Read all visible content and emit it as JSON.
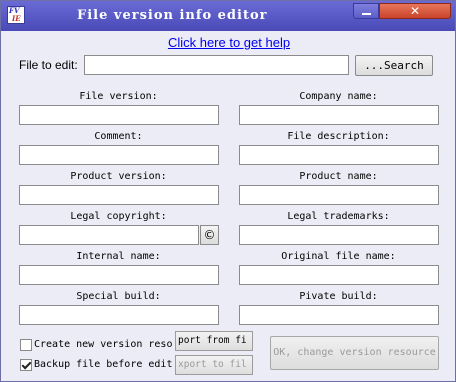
{
  "window": {
    "title": "File version info editor",
    "icon_text_top": "FV",
    "icon_text_bottom": "IE",
    "close_glyph": "✕"
  },
  "help_link": "Click here to get help",
  "file": {
    "label": "File to edit:",
    "value": "",
    "search_label": "...Search"
  },
  "fields": {
    "file_version": {
      "label": "File version:",
      "value": ""
    },
    "company_name": {
      "label": "Company name:",
      "value": ""
    },
    "comment": {
      "label": "Comment:",
      "value": ""
    },
    "file_description": {
      "label": "File description:",
      "value": ""
    },
    "product_version": {
      "label": "Product version:",
      "value": ""
    },
    "product_name": {
      "label": "Product name:",
      "value": ""
    },
    "legal_copyright": {
      "label": "Legal copyright:",
      "value": ""
    },
    "legal_trademarks": {
      "label": "Legal trademarks:",
      "value": ""
    },
    "internal_name": {
      "label": "Internal name:",
      "value": ""
    },
    "original_file_name": {
      "label": "Original file name:",
      "value": ""
    },
    "special_build": {
      "label": "Special build:",
      "value": ""
    },
    "private_build": {
      "label": "Pivate build:",
      "value": ""
    }
  },
  "copyright_symbol": "©",
  "options": {
    "create_new": {
      "label": "Create new version reso",
      "checked": false
    },
    "backup": {
      "label": "Backup file before edit",
      "checked": true
    }
  },
  "buttons": {
    "import_label": "port from fi",
    "export_label": "xport to fil",
    "ok_label": "OK, change version resource"
  }
}
